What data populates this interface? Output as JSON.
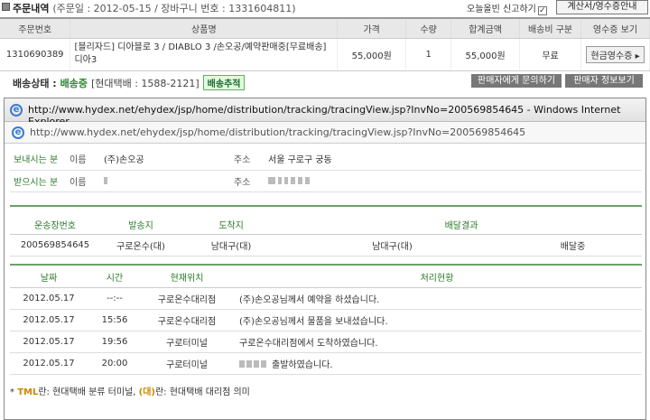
{
  "order": {
    "title": "주문내역",
    "meta": "(주문일 : 2012-05-15 / 장바구니 번호 : 1331604811)",
    "wrong_post_label": "오늘올빈 신고하기",
    "receipt_guide": "계산서/영수증안내",
    "columns": [
      "주문번호",
      "상품명",
      "가격",
      "수량",
      "합계금액",
      "배송비 구분",
      "영수증 보기"
    ],
    "rows": [
      {
        "order_no": "1310690389",
        "product": "[블리자드] 디아블로 3 / DIABLO 3 /손오공/예약판매중[무료배송] 디아3",
        "price": "55,000원",
        "qty": "1",
        "total": "55,000원",
        "shipping": "무료",
        "receipt_btn": "현금영수증"
      }
    ]
  },
  "status": {
    "label": "배송상태 :",
    "value": "배송중",
    "carrier": "[현대택배 : 1588-2121]",
    "track_btn": "배송추적",
    "ask_seller": "판매자에게 문의하기",
    "seller_info": "판매자 정보보기"
  },
  "ie": {
    "title": "http://www.hydex.net/ehydex/jsp/home/distribution/tracking/tracingView.jsp?InvNo=200569854645 - Windows Internet Explorer",
    "url": "http://www.hydex.net/ehydex/jsp/home/distribution/tracking/tracingView.jsp?InvNo=200569854645"
  },
  "sender": {
    "label": "보내시는 분",
    "name_key": "이름",
    "name": "(주)손오공",
    "addr_key": "주소",
    "addr": "서울 구로구 궁동"
  },
  "receiver": {
    "label": "받으시는 분",
    "name_key": "이름",
    "addr_key": "주소"
  },
  "summary": {
    "columns": [
      "운송장번호",
      "발송지",
      "도착지",
      "배달결과"
    ],
    "row": [
      "200569854645",
      "구로온수(대)",
      "남대구(대)",
      "남대구(대)",
      "배달중"
    ]
  },
  "history": {
    "columns": [
      "날짜",
      "시간",
      "현재위치",
      "처리현황"
    ],
    "rows": [
      [
        "2012.05.17",
        "--:--",
        "구로온수대리점",
        "(주)손오공님께서 예약을 하셨습니다."
      ],
      [
        "2012.05.17",
        "15:56",
        "구로온수대리점",
        "(주)손오공님께서 물품을 보내셨습니다."
      ],
      [
        "2012.05.17",
        "19:56",
        "구로터미널",
        "구로온수대리점에서 도착하였습니다."
      ],
      [
        "2012.05.17",
        "20:00",
        "구로터미널",
        "출발하였습니다."
      ]
    ]
  },
  "note": {
    "star": "*",
    "tml": "TML",
    "text1": "란: 현대택배 분류 터미널,",
    "dae": "(대)",
    "text2": "란: 현대택배 대리점 의미"
  }
}
